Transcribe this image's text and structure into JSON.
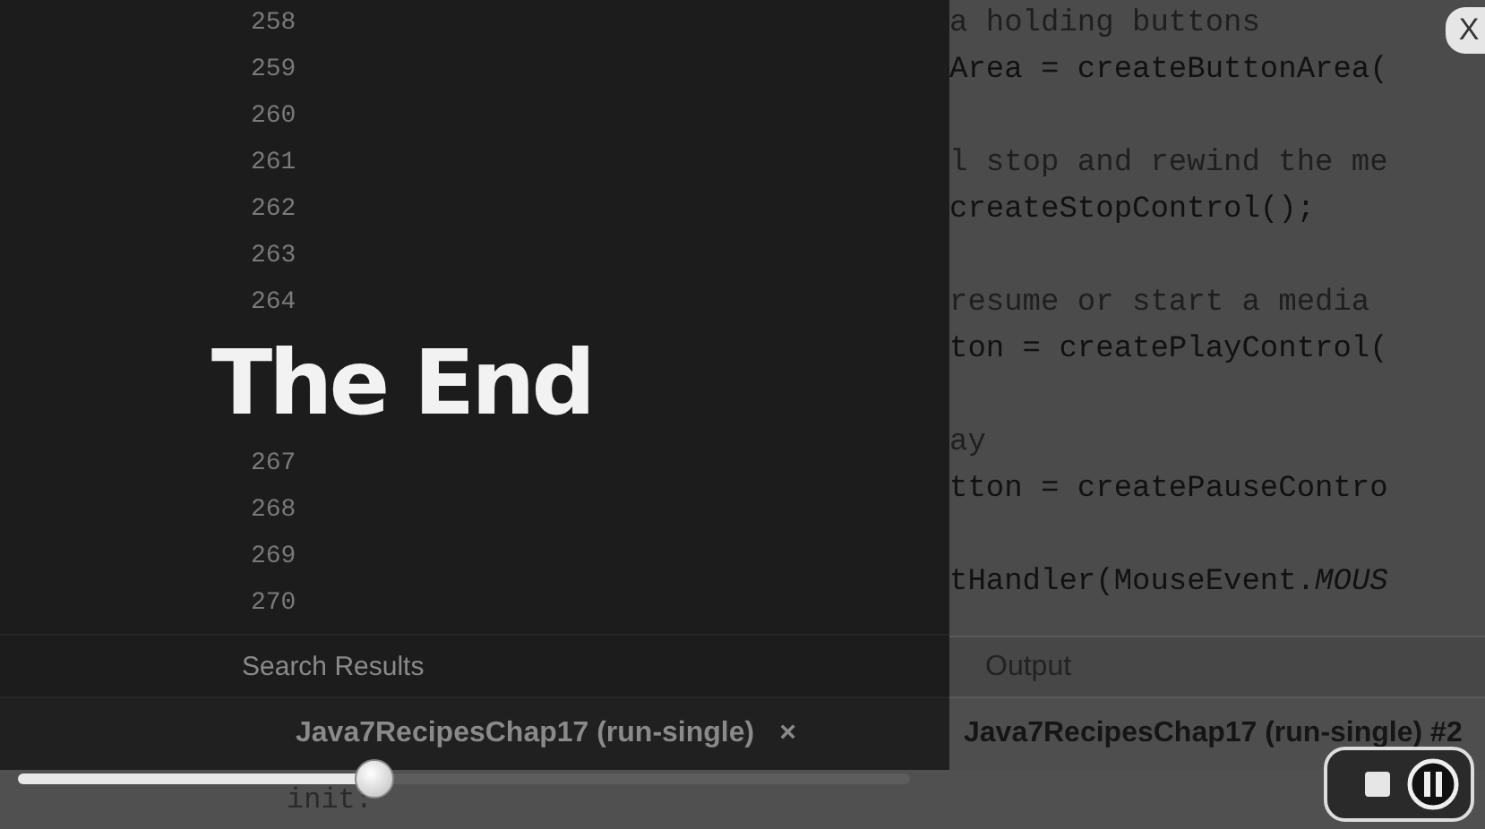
{
  "video": {
    "title": "The End",
    "lines_above": [
      "258",
      "259",
      "260",
      "261",
      "262",
      "263",
      "264"
    ],
    "lines_below": [
      "267",
      "268",
      "269",
      "270"
    ],
    "tabs": [
      {
        "label": "Search Results"
      }
    ],
    "run_tab": {
      "label": "Java7RecipesChap17 (run-single)",
      "close": "×"
    }
  },
  "code": [
    {
      "kind": "comment",
      "text": "a holding buttons"
    },
    {
      "kind": "code",
      "text": "Area = createButtonArea("
    },
    {
      "kind": "blank"
    },
    {
      "kind": "comment",
      "text": "l stop and rewind the me"
    },
    {
      "kind": "code",
      "text": "createStopControl();"
    },
    {
      "kind": "blank"
    },
    {
      "kind": "comment",
      "text": "resume or start a media"
    },
    {
      "kind": "code",
      "text": "ton = createPlayControl("
    },
    {
      "kind": "blank"
    },
    {
      "kind": "comment",
      "text": "ay"
    },
    {
      "kind": "code",
      "text": "tton = createPauseContro"
    },
    {
      "kind": "blank"
    },
    {
      "kind": "code",
      "text": "tHandler(MouseEvent.*MOUS*"
    }
  ],
  "output_tab": {
    "label": "Output"
  },
  "run_tab": {
    "label": "Java7RecipesChap17 (run-single) #2"
  },
  "console": {
    "text": "init:"
  },
  "player": {
    "level": 0.4,
    "close": "X"
  }
}
